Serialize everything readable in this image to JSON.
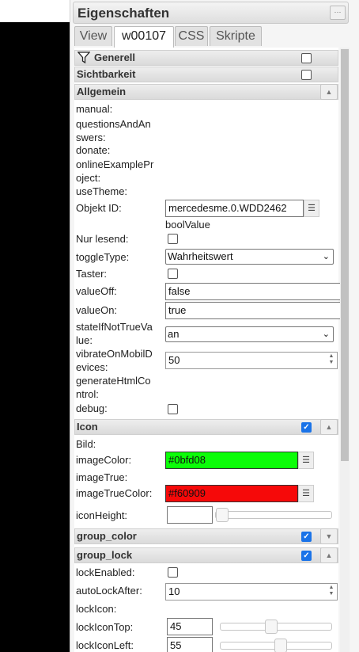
{
  "panel": {
    "title": "Eigenschaften",
    "menu_icon": "···"
  },
  "tabs": [
    "View",
    "w00107",
    "CSS",
    "Skripte"
  ],
  "groups": {
    "generell": "Generell",
    "sichtbarkeit": "Sichtbarkeit",
    "allgemein": "Allgemein",
    "icon": "Icon",
    "group_color": "group_color",
    "group_lock": "group_lock"
  },
  "labels": {
    "manual": "manual:",
    "questions": "questionsAndAn\nswers:",
    "donate": "donate:",
    "online": "onlineExamplePr\noject:",
    "usetheme": "useTheme:",
    "objektid": "Objekt ID:",
    "nurlesend": "Nur lesend:",
    "toggletype": "toggleType:",
    "taster": "Taster:",
    "valueoff": "valueOff:",
    "valueon": "valueOn:",
    "stateif": "stateIfNotTrueVa\nlue:",
    "vibrate": "vibrateOnMobilD\nevices:",
    "generatehtml": "generateHtmlCo\nntrol:",
    "debug": "debug:",
    "bild": "Bild:",
    "imagecolor": "imageColor:",
    "imagetrue": "imageTrue:",
    "imagetruecolor": "imageTrueColor:",
    "iconheight": "iconHeight:",
    "lockenabled": "lockEnabled:",
    "autolock": "autoLockAfter:",
    "lockicon": "lockIcon:",
    "lockicontop": "lockIconTop:",
    "lockiconleft": "lockIconLeft:"
  },
  "values": {
    "objektid": "mercedesme.0.WDD2462",
    "objektid_type": "boolValue",
    "toggletype": "Wahrheitswert",
    "valueoff": "false",
    "valueon": "true",
    "stateif": "an",
    "vibrate": "50",
    "imagecolor": "#0bfd08",
    "imagetruecolor": "#f60909",
    "autolock": "10",
    "lockicontop": "45",
    "lockiconleft": "55"
  },
  "levels": {
    "iconheight": 0,
    "lockicontop": 0.45,
    "lockiconleft": 0.55
  },
  "colors": {
    "imagecolor": "#0bfd08",
    "imagetruecolor": "#f60909",
    "checkbox_on": "#1a73e8"
  }
}
